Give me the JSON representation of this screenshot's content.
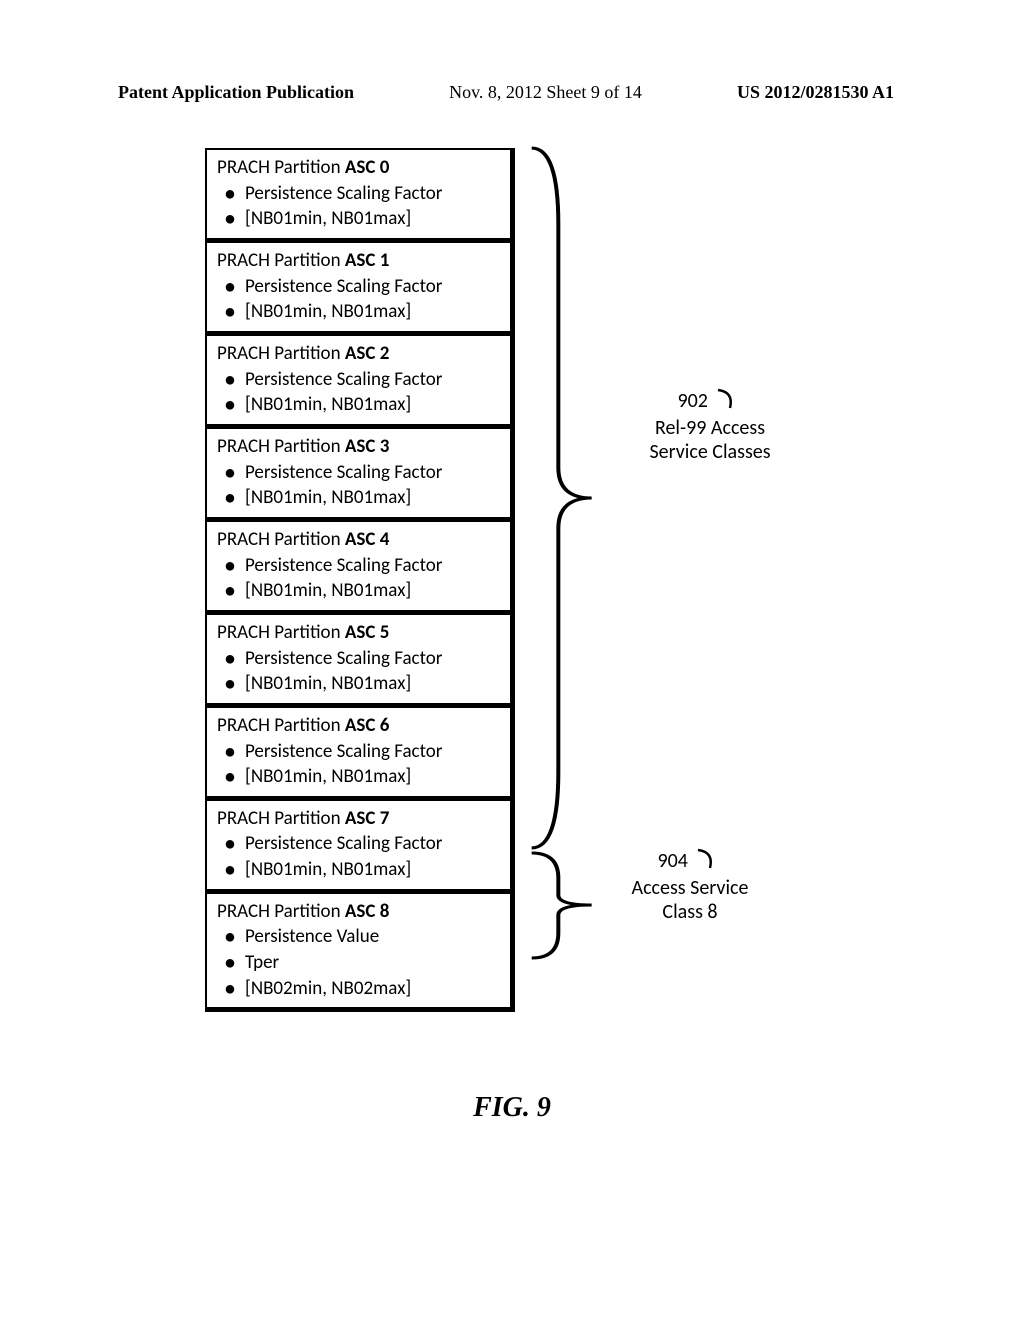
{
  "header": {
    "left": "Patent Application Publication",
    "center": "Nov. 8, 2012   Sheet 9 of 14",
    "right": "US 2012/0281530 A1"
  },
  "partitions": [
    {
      "id": 0,
      "title_prefix": "PRACH Partition ",
      "title_bold": "ASC 0",
      "items": [
        "Persistence Scaling Factor",
        "[NB01min, NB01max]"
      ]
    },
    {
      "id": 1,
      "title_prefix": "PRACH Partition ",
      "title_bold": "ASC 1",
      "items": [
        "Persistence Scaling Factor",
        "[NB01min, NB01max]"
      ]
    },
    {
      "id": 2,
      "title_prefix": "PRACH Partition ",
      "title_bold": "ASC 2",
      "items": [
        "Persistence Scaling Factor",
        "[NB01min, NB01max]"
      ]
    },
    {
      "id": 3,
      "title_prefix": "PRACH Partition ",
      "title_bold": "ASC 3",
      "items": [
        "Persistence Scaling Factor",
        "[NB01min, NB01max]"
      ]
    },
    {
      "id": 4,
      "title_prefix": "PRACH Partition ",
      "title_bold": "ASC 4",
      "items": [
        "Persistence Scaling Factor",
        "[NB01min, NB01max]"
      ]
    },
    {
      "id": 5,
      "title_prefix": "PRACH Partition ",
      "title_bold": "ASC 5",
      "items": [
        "Persistence Scaling Factor",
        "[NB01min, NB01max]"
      ]
    },
    {
      "id": 6,
      "title_prefix": "PRACH Partition ",
      "title_bold": "ASC 6",
      "items": [
        "Persistence Scaling Factor",
        "[NB01min, NB01max]"
      ]
    },
    {
      "id": 7,
      "title_prefix": "PRACH Partition ",
      "title_bold": "ASC 7",
      "items": [
        "Persistence Scaling Factor",
        "[NB01min, NB01max]"
      ]
    },
    {
      "id": 8,
      "title_prefix": "PRACH Partition ",
      "title_bold": "ASC 8",
      "items": [
        "Persistence Value",
        "Tper",
        "[NB02min, NB02max]"
      ]
    }
  ],
  "labels": {
    "ref902": "902",
    "text902_line1": "Rel-99 Access",
    "text902_line2": "Service Classes",
    "ref904": "904",
    "text904_line1": "Access Service",
    "text904_line2": "Class 8"
  },
  "figure": "FIG. 9"
}
